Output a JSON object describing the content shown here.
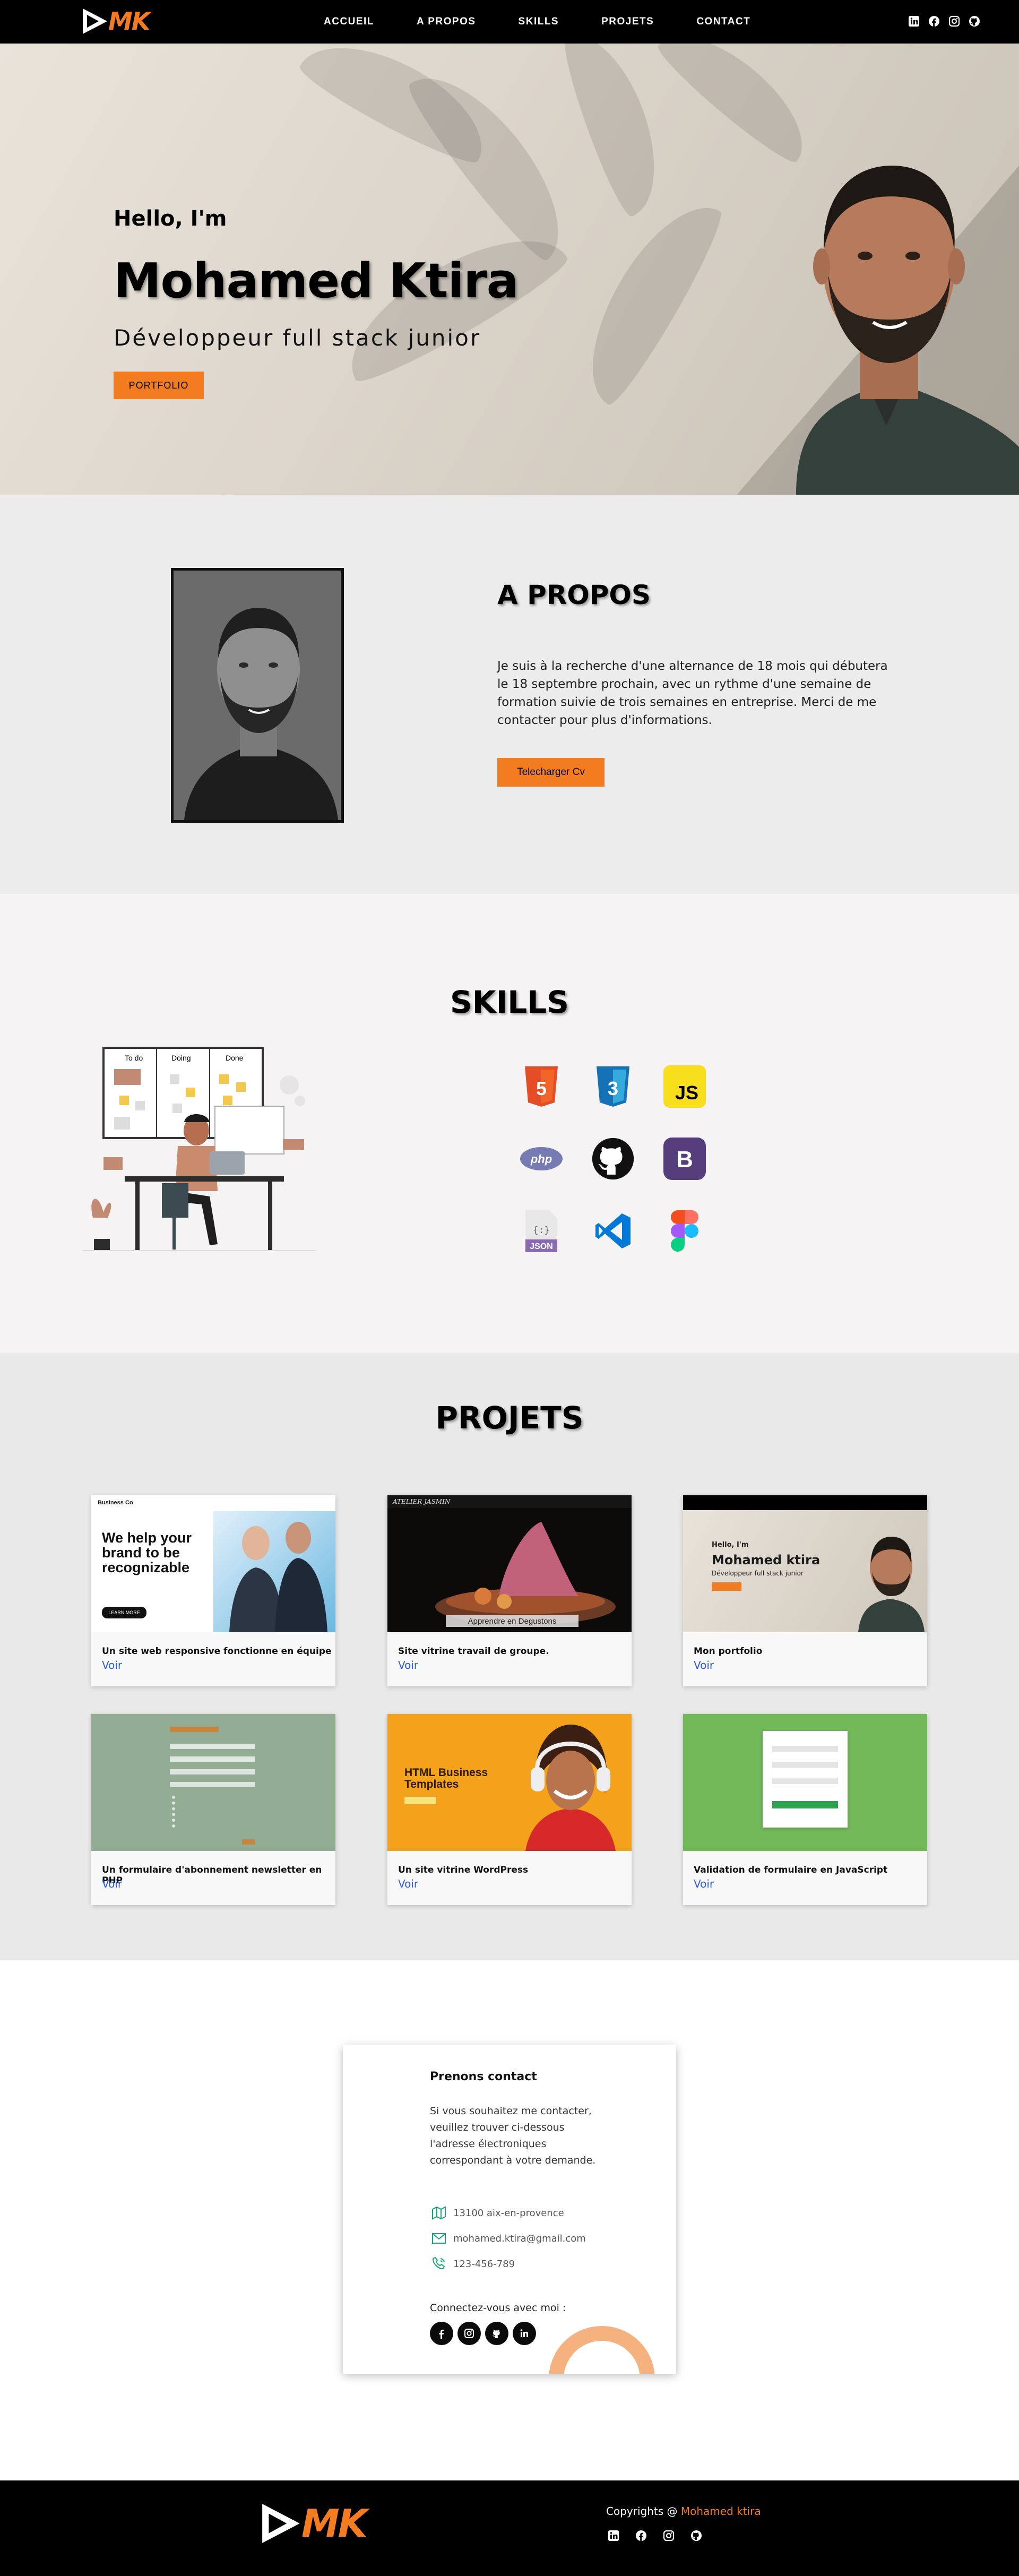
{
  "colors": {
    "accent": "#f47c20",
    "link": "#2b5cd6",
    "dark": "#000000"
  },
  "brand": {
    "logo_text": "MK"
  },
  "nav": {
    "links": [
      "ACCUEIL",
      "A PROPOS",
      "SKILLS",
      "PROJETS",
      "CONTACT"
    ],
    "social_icons": [
      "linkedin-icon",
      "facebook-icon",
      "instagram-icon",
      "github-icon"
    ]
  },
  "hero": {
    "greeting": "Hello, I'm",
    "name": "Mohamed Ktira",
    "role": "Développeur full stack junior",
    "button": "PORTFOLIO"
  },
  "about": {
    "title": "A PROPOS",
    "text": "Je suis à la recherche d'une alternance de 18 mois qui débutera le 18 septembre prochain, avec un rythme d'une semaine de formation suivie de trois semaines en entreprise. Merci de me contacter pour plus d'informations.",
    "button": "Telecharger Cv"
  },
  "skills": {
    "title": "SKILLS",
    "illustration_labels": {
      "todo": "To do",
      "doing": "Doing",
      "done": "Done"
    },
    "items": [
      {
        "name": "html5-icon",
        "label": "5"
      },
      {
        "name": "css3-icon",
        "label": "3"
      },
      {
        "name": "javascript-icon",
        "label": "JS"
      },
      {
        "name": "php-icon",
        "label": "php"
      },
      {
        "name": "github-icon",
        "label": ""
      },
      {
        "name": "bootstrap-icon",
        "label": "B"
      },
      {
        "name": "json-icon",
        "label": "JSON"
      },
      {
        "name": "vscode-icon",
        "label": ""
      },
      {
        "name": "figma-icon",
        "label": ""
      }
    ]
  },
  "projects": {
    "title": "PROJETS",
    "link_label": "Voir",
    "items": [
      {
        "title": "Un site web responsive fonctionne en équipe",
        "thumb": {
          "brand": "Business Co",
          "headline": "We help your brand to be recognizable",
          "cta": "LEARN MORE"
        }
      },
      {
        "title": "Site vitrine travail de groupe.",
        "thumb": {
          "brand": "ATELIER JASMIN",
          "tagline": "Apprendre en Degustons"
        }
      },
      {
        "title": "Mon portfolio",
        "thumb": {
          "greeting": "Hello, I'm",
          "name": "Mohamed ktira",
          "role": "Développeur full stack junior"
        }
      },
      {
        "title": "Un formulaire d'abonnement newsletter en PHP",
        "thumb": {}
      },
      {
        "title": "Un site vitrine WordPress",
        "thumb": {
          "headline": "HTML Business Templates"
        }
      },
      {
        "title": "Validation de formulaire en JavaScript",
        "thumb": {}
      }
    ]
  },
  "contact": {
    "title": "Prenons contact",
    "text": "Si vous souhaitez me contacter, veuillez trouver ci-dessous l'adresse électroniques correspondant à votre demande.",
    "address": "13100 aix-en-provence",
    "email": "mohamed.ktira@gmail.com",
    "phone": "123-456-789",
    "connect": "Connectez-vous avec moi :",
    "social_icons": [
      "facebook-icon",
      "instagram-icon",
      "github-icon",
      "linkedin-icon"
    ]
  },
  "footer": {
    "copy_prefix": "Copyrights @",
    "copy_name": "Mohamed ktira",
    "social_icons": [
      "linkedin-icon",
      "facebook-icon",
      "instagram-icon",
      "github-icon"
    ]
  }
}
